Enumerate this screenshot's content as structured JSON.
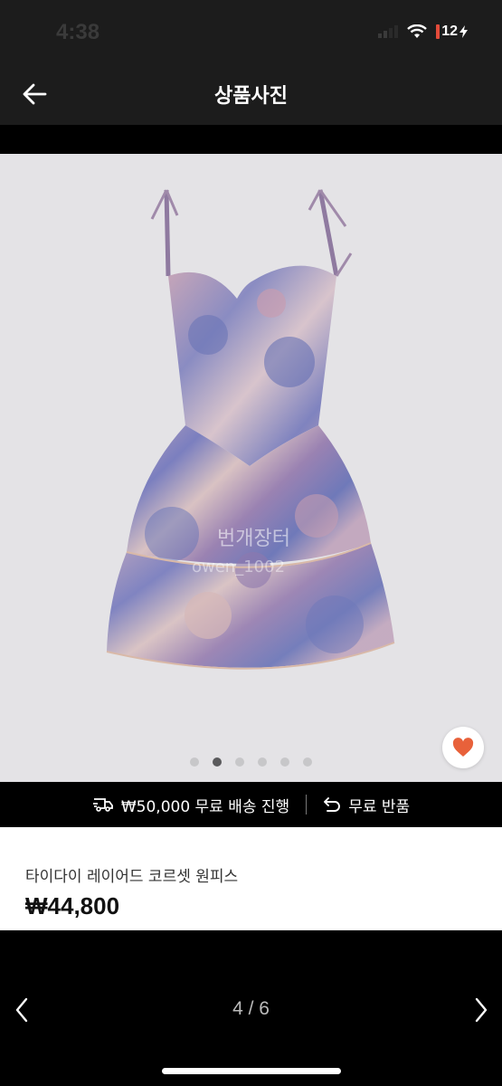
{
  "status_bar": {
    "time": "4:38",
    "battery": "12"
  },
  "header": {
    "title": "상품사진"
  },
  "gallery": {
    "total_dots": 6,
    "active_dot": 2,
    "watermark": [
      "번개장터",
      "owen_1002"
    ]
  },
  "shipping": {
    "free_shipping_label": "₩50,000 무료 배송 진행",
    "free_return_label": "무료 반품"
  },
  "product": {
    "name": "타이다이 레이어드 코르셋 원피스",
    "price": "₩44,800"
  },
  "pager": {
    "counter": "4 / 6"
  },
  "colors": {
    "heart": "#e8613a",
    "image_bg": "#e4e3e6",
    "battery_red": "#e34b3a"
  }
}
